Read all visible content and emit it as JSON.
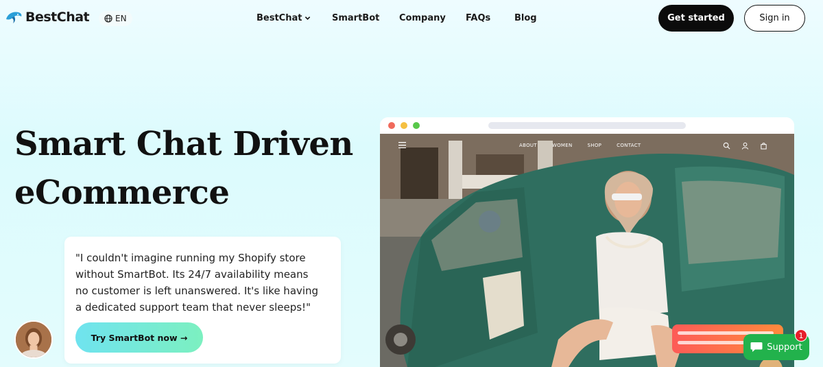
{
  "brand": {
    "name": "BestChat",
    "accent": "#2a9fd8"
  },
  "language": {
    "code": "EN",
    "icon": "globe-icon"
  },
  "nav": {
    "items": [
      {
        "label": "BestChat",
        "has_dropdown": true
      },
      {
        "label": "SmartBot"
      },
      {
        "label": "Company"
      },
      {
        "label": "FAQs"
      },
      {
        "label": "Blog"
      }
    ]
  },
  "actions": {
    "get_started": "Get started",
    "sign_in": "Sign in"
  },
  "hero": {
    "title_line1": "Smart Chat Driven",
    "title_line2": "eCommerce",
    "quote": "\"I couldn't imagine running my Shopify store without SmartBot. Its 24/7 availability means no customer is left unanswered. It's like having a dedicated support team that never sleeps!\"",
    "cta": "Try SmartBot now →"
  },
  "mockup": {
    "site_nav": [
      "ABOUT",
      "WOMEN",
      "SHOP",
      "CONTACT"
    ],
    "colors": {
      "car": "#2f6e5f",
      "street": "#8a8174"
    }
  },
  "support": {
    "label": "Support",
    "badge_count": "1",
    "color": "#22b24c"
  }
}
